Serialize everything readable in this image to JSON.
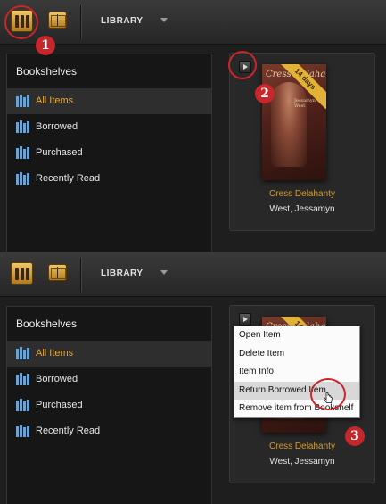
{
  "toolbar": {
    "title": "LIBRARY"
  },
  "sidebar": {
    "title": "Bookshelves",
    "items": [
      {
        "label": "All Items",
        "active": true
      },
      {
        "label": "Borrowed"
      },
      {
        "label": "Purchased"
      },
      {
        "label": "Recently Read"
      }
    ]
  },
  "book": {
    "title": "Cress Delahanty",
    "author": "West, Jessamyn",
    "cover_title": "Cress Delahanty",
    "cover_author": "Jessamyn West",
    "ribbon": "14 days"
  },
  "context_menu": {
    "items": [
      "Open Item",
      "Delete Item",
      "Item Info",
      "Return Borrowed Item",
      "Remove item from Bookshelf"
    ],
    "hovered": "Return Borrowed Item"
  },
  "callouts": [
    "1",
    "2",
    "3"
  ],
  "colors": {
    "accent": "#e5a93a",
    "callout": "#c7262a",
    "ribbon": "#e1b235"
  }
}
